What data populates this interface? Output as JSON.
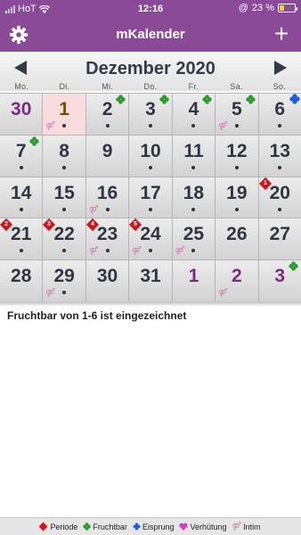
{
  "status": {
    "carrier": "HoT",
    "time": "12:16",
    "battery": "23 %"
  },
  "nav": {
    "title": "mKalender",
    "add_label": "+"
  },
  "calendar": {
    "month_title": "Dezember 2020",
    "weekdays": [
      "Mo.",
      "Di.",
      "Mi.",
      "Do.",
      "Fr.",
      "Sa.",
      "So."
    ],
    "days": [
      {
        "n": "30",
        "other": true,
        "dot": false
      },
      {
        "n": "1",
        "today": true,
        "dot": true,
        "intim": true
      },
      {
        "n": "2",
        "dot": true,
        "clover": true
      },
      {
        "n": "3",
        "dot": true,
        "clover": true
      },
      {
        "n": "4",
        "dot": true,
        "clover": true
      },
      {
        "n": "5",
        "dot": true,
        "clover": true,
        "intim": true
      },
      {
        "n": "6",
        "dot": true,
        "blue": true
      },
      {
        "n": "7",
        "dot": true,
        "clover": true
      },
      {
        "n": "8",
        "dot": true
      },
      {
        "n": "9"
      },
      {
        "n": "10",
        "dot": true
      },
      {
        "n": "11",
        "dot": true
      },
      {
        "n": "12",
        "dot": true
      },
      {
        "n": "13",
        "dot": true
      },
      {
        "n": "14",
        "dot": true
      },
      {
        "n": "15",
        "dot": true
      },
      {
        "n": "16",
        "dot": true,
        "intim": true
      },
      {
        "n": "17",
        "dot": true
      },
      {
        "n": "18",
        "dot": true
      },
      {
        "n": "19",
        "dot": true
      },
      {
        "n": "20",
        "dot": true,
        "badge": "1"
      },
      {
        "n": "21",
        "dot": true,
        "badge": "2"
      },
      {
        "n": "22",
        "dot": true,
        "badge": "3"
      },
      {
        "n": "23",
        "dot": true,
        "badge": "4",
        "intim": true
      },
      {
        "n": "24",
        "dot": true,
        "badge": "5",
        "intim": true
      },
      {
        "n": "25",
        "dot": true,
        "intim": true
      },
      {
        "n": "26"
      },
      {
        "n": "27"
      },
      {
        "n": "28"
      },
      {
        "n": "29",
        "dot": true,
        "intim": true
      },
      {
        "n": "30"
      },
      {
        "n": "31"
      },
      {
        "n": "1",
        "other": true
      },
      {
        "n": "2",
        "other": true,
        "intim": true
      },
      {
        "n": "3",
        "other": true,
        "clover": true
      }
    ]
  },
  "note": "Fruchtbar von 1-6 ist eingezeichnet",
  "legend": {
    "periode": "Periode",
    "fruchtbar": "Fruchtbar",
    "eisprung": "Eisprung",
    "verhuetung": "Verhütung",
    "intim": "Intim"
  },
  "colors": {
    "accent": "#8a4a98",
    "periode": "#d0141a",
    "fruchtbar": "#2e9b2e",
    "eisprung": "#1e5fd8",
    "verhuetung": "#d63cc8",
    "intim": "#c97fb2"
  }
}
